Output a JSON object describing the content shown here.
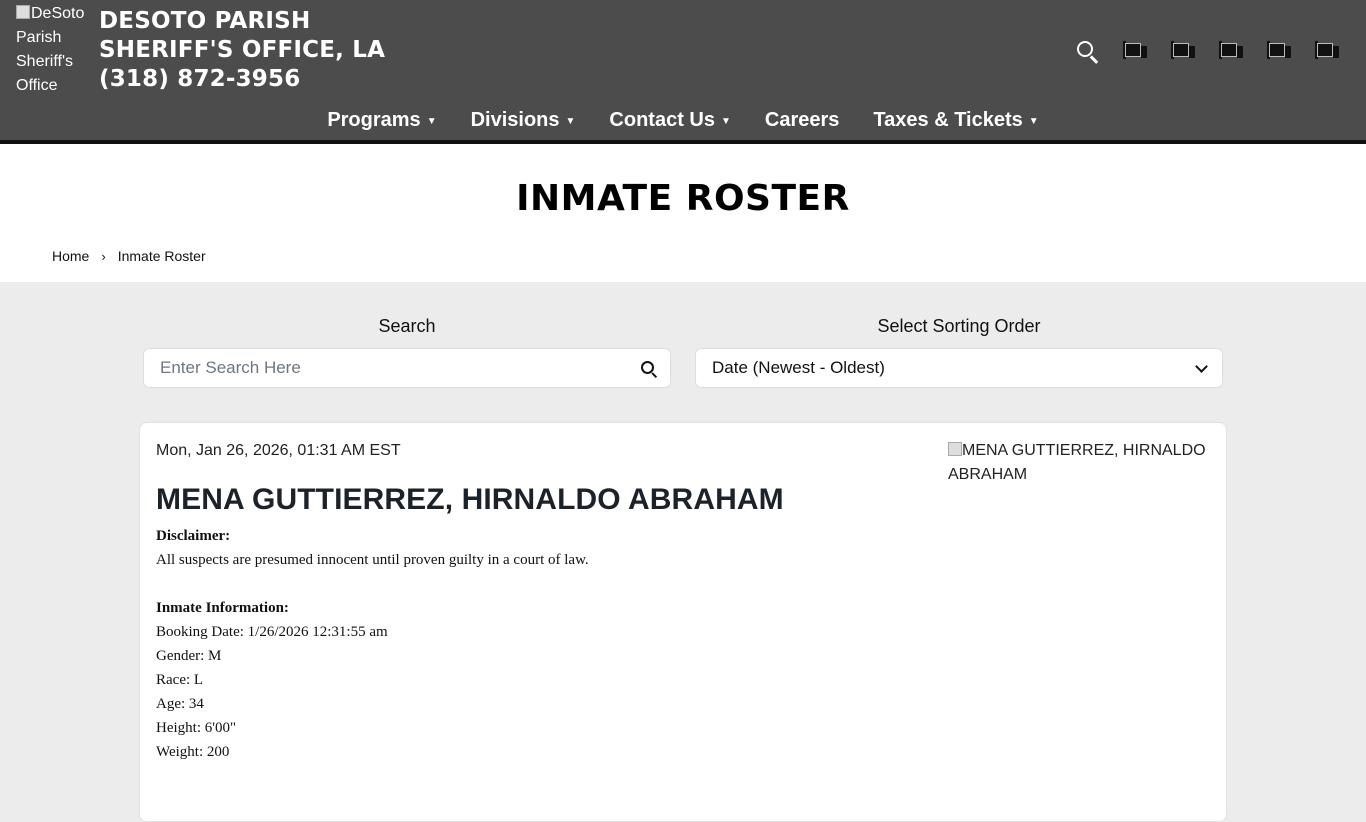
{
  "header": {
    "logo_alt": "DeSoto Parish Sheriff's Office",
    "title_line1": "DESOTO PARISH",
    "title_line2": "SHERIFF'S OFFICE, LA",
    "phone": "(318) 872-3956",
    "tools": [
      "search-icon",
      "social-link-icon",
      "social-link-icon",
      "social-link-icon",
      "social-link-icon",
      "social-link-icon"
    ]
  },
  "nav": {
    "items": [
      {
        "label": "Programs",
        "dropdown": true
      },
      {
        "label": "Divisions",
        "dropdown": true
      },
      {
        "label": "Contact Us",
        "dropdown": true
      },
      {
        "label": "Careers",
        "dropdown": false
      },
      {
        "label": "Taxes & Tickets",
        "dropdown": true
      }
    ]
  },
  "page": {
    "title": "INMATE ROSTER",
    "breadcrumb": {
      "home": "Home",
      "separator": "›",
      "current": "Inmate Roster"
    }
  },
  "filters": {
    "search_label": "Search",
    "search_placeholder": "Enter Search Here",
    "sort_label": "Select Sorting Order",
    "sort_value": "Date (Newest - Oldest)"
  },
  "inmate": {
    "timestamp": "Mon, Jan 26, 2026, 01:31 AM EST",
    "photo_alt": "MENA GUTTIERREZ, HIRNALDO ABRAHAM",
    "name": "MENA GUTTIERREZ, HIRNALDO ABRAHAM",
    "disclaimer_heading": "Disclaimer:",
    "disclaimer_text": "All suspects are presumed innocent until proven guilty in a court of law.",
    "info_heading": "Inmate Information:",
    "booking_date": "Booking Date: 1/26/2026 12:31:55 am",
    "gender": "Gender: M",
    "race": "Race: L",
    "age": "Age: 34",
    "height": "Height: 6'00\"",
    "weight": "Weight: 200"
  },
  "colors": {
    "header_bg": "#4c4c4c",
    "page_bg": "#ececec",
    "accent_text": "#ffffff"
  }
}
